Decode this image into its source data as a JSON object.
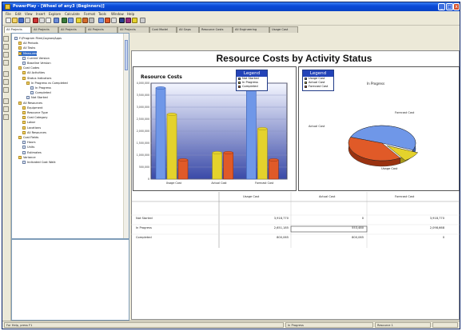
{
  "window": {
    "title": "PowerPlay - [Wheel of any3 (Beginners)]",
    "min_label": "_",
    "max_label": "□",
    "close_label": "x"
  },
  "menu": [
    "File",
    "Edit",
    "View",
    "Insert",
    "Explore",
    "Calculate",
    "Format",
    "Tools",
    "Window",
    "Help"
  ],
  "tabs": [
    "All Projects",
    "All Projects",
    "All Projects",
    "All Projects",
    "All Projects",
    "Cost Model",
    "All Gaps",
    "Resource Costs",
    "All Engineering",
    "Usage Cost"
  ],
  "tree": [
    {
      "label": "F:\\Program Files\\Cognos\\Apps",
      "depth": 0,
      "icon": "doc"
    },
    {
      "label": "All Periods",
      "depth": 1,
      "icon": "folder"
    },
    {
      "label": "All Tasks",
      "depth": 1,
      "icon": "folder"
    },
    {
      "label": "Measures",
      "depth": 1,
      "icon": "folder",
      "selected": true
    },
    {
      "label": "Current Version",
      "depth": 2,
      "icon": "doc"
    },
    {
      "label": "Baseline Version",
      "depth": 2,
      "icon": "doc"
    },
    {
      "label": "Cost Codes",
      "depth": 1,
      "icon": "folder"
    },
    {
      "label": "All Activities",
      "depth": 2,
      "icon": "folder"
    },
    {
      "label": "Status Indicators",
      "depth": 2,
      "icon": "folder"
    },
    {
      "label": "In Progress vs Completed",
      "depth": 3,
      "icon": "folder"
    },
    {
      "label": "In Progress",
      "depth": 4,
      "icon": "doc"
    },
    {
      "label": "Completed",
      "depth": 4,
      "icon": "doc"
    },
    {
      "label": "Not Started",
      "depth": 3,
      "icon": "doc"
    },
    {
      "label": "All Resources",
      "depth": 1,
      "icon": "folder"
    },
    {
      "label": "Equipment",
      "depth": 2,
      "icon": "folder"
    },
    {
      "label": "Resource Type",
      "depth": 2,
      "icon": "folder"
    },
    {
      "label": "Cost Category",
      "depth": 2,
      "icon": "folder"
    },
    {
      "label": "Labor",
      "depth": 2,
      "icon": "folder"
    },
    {
      "label": "Locations",
      "depth": 2,
      "icon": "folder"
    },
    {
      "label": "All Resources",
      "depth": 2,
      "icon": "folder"
    },
    {
      "label": "Cost Fields",
      "depth": 1,
      "icon": "folder"
    },
    {
      "label": "Hours",
      "depth": 2,
      "icon": "doc"
    },
    {
      "label": "Units",
      "depth": 2,
      "icon": "doc"
    },
    {
      "label": "Estimates",
      "depth": 2,
      "icon": "doc"
    },
    {
      "label": "Variance",
      "depth": 1,
      "icon": "folder"
    },
    {
      "label": "Indicated Cost Walk",
      "depth": 2,
      "icon": "doc"
    }
  ],
  "report": {
    "title": "Resource Costs by Activity Status"
  },
  "bar_panel": {
    "title": "Resource Costs",
    "legend_title": "Legend",
    "legend_items": [
      "Not Started",
      "In Progress",
      "Completed"
    ]
  },
  "pie_panel": {
    "legend_title": "Legend",
    "legend_items": [
      "Usage Cost",
      "Actual Cost",
      "Forecast Cost"
    ],
    "status_label": "In Progress",
    "slice_labels": [
      "Forecast Cost",
      "Usage Cost",
      "Actual Cost"
    ]
  },
  "colors": {
    "blue": "#6f97e8",
    "yellow": "#e4d22c",
    "red": "#e05a28",
    "legend_header": "#2343b8",
    "selection": "#316ac5"
  },
  "chart_data": [
    {
      "type": "bar",
      "title": "Resource Costs",
      "categories": [
        "Usage Cost",
        "Actual Cost",
        "Forecast Cost"
      ],
      "series": [
        {
          "name": "Not Started",
          "values": [
            3800000,
            0,
            3900000
          ]
        },
        {
          "name": "In Progress",
          "values": [
            2700000,
            1100000,
            2100000
          ]
        },
        {
          "name": "Completed",
          "values": [
            800000,
            1100000,
            800000
          ]
        }
      ],
      "ylim": [
        0,
        4000000
      ],
      "grid": true,
      "legend": "top-right"
    },
    {
      "type": "pie",
      "title": "In Progress",
      "categories": [
        "Usage Cost",
        "Actual Cost",
        "Forecast Cost"
      ],
      "values": [
        2700000,
        500000,
        2100000
      ],
      "legend": "top-left"
    }
  ],
  "table": {
    "columns": [
      "Usage Cost",
      "Actual Cost",
      "Forecast Cost"
    ],
    "rows": [
      {
        "label": "Not Started",
        "values": [
          "3,918,770",
          "0",
          "3,918,770"
        ]
      },
      {
        "label": "In Progress",
        "values": [
          "2,651,185",
          "553,480",
          "2,098,668"
        ]
      },
      {
        "label": "Completed",
        "values": [
          "800,065",
          "800,065",
          "0"
        ]
      }
    ]
  },
  "status": {
    "message": "For Help, press F1",
    "cell": "In Progress",
    "zoom": "Resource 1"
  }
}
